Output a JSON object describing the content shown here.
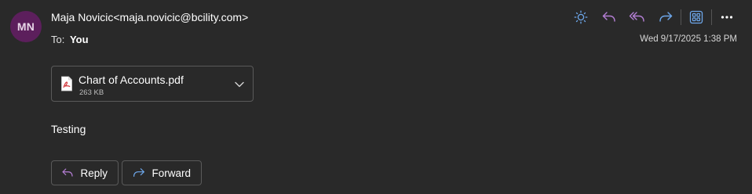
{
  "message": {
    "avatar_initials": "MN",
    "sender": "Maja Novicic<maja.novicic@bcility.com>",
    "to_label": "To:",
    "to_value": "You",
    "timestamp": "Wed 9/17/2025 1:38 PM",
    "body": "Testing"
  },
  "toolbar": {
    "icons": [
      "sun-icon",
      "reply-icon",
      "reply-all-icon",
      "forward-icon",
      "apps-icon",
      "more-icon"
    ]
  },
  "attachment": {
    "name": "Chart of Accounts.pdf",
    "size": "263 KB",
    "icon": "pdf-file-icon"
  },
  "actions": {
    "reply_label": "Reply",
    "forward_label": "Forward"
  },
  "colors": {
    "background": "#292929",
    "avatar": "#5c1f5c",
    "reply_accent": "#b57fd6",
    "forward_accent": "#6ea8ec",
    "pdf_red": "#d13438"
  }
}
